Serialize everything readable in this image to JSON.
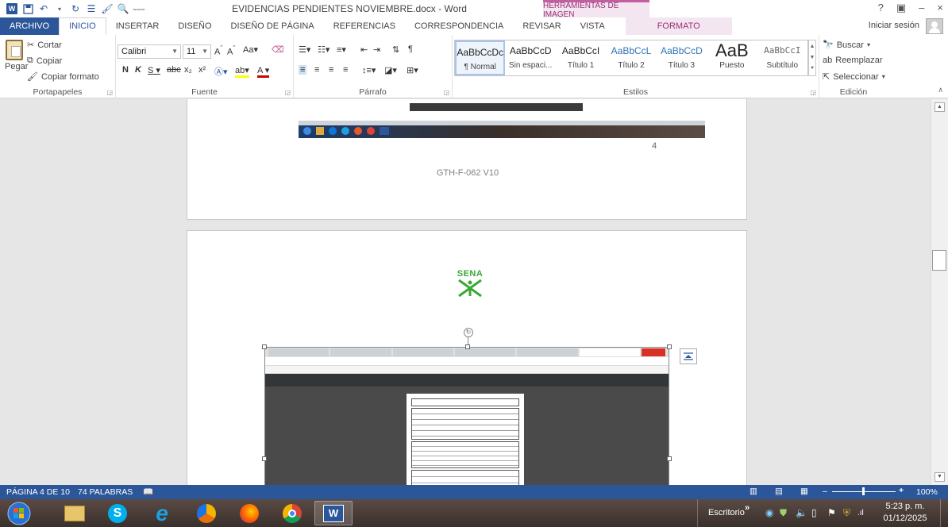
{
  "window": {
    "doc_title": "EVIDENCIAS PENDIENTES  NOVIEMBRE.docx - Word",
    "context_group": "HERRAMIENTAS DE IMAGEN",
    "controls": [
      "?",
      "▣",
      "–",
      "×"
    ]
  },
  "tabs": {
    "items": [
      "ARCHIVO",
      "INICIO",
      "INSERTAR",
      "DISEÑO",
      "DISEÑO DE PÁGINA",
      "REFERENCIAS",
      "CORRESPONDENCIA",
      "REVISAR",
      "VISTA",
      "FORMATO"
    ],
    "signin": "Iniciar sesión"
  },
  "ribbon": {
    "clipboard": {
      "paste": "Pegar",
      "cut": "Cortar",
      "copy": "Copiar",
      "format_painter": "Copiar formato",
      "label": "Portapapeles"
    },
    "font": {
      "name": "Calibri",
      "size": "11",
      "label": "Fuente"
    },
    "paragraph": {
      "label": "Párrafo"
    },
    "styles": {
      "label": "Estilos",
      "items": [
        {
          "sample": "AaBbCcDc",
          "name": "¶ Normal"
        },
        {
          "sample": "AaBbCcD",
          "name": "Sin espaci..."
        },
        {
          "sample": "AaBbCcI",
          "name": "Título 1"
        },
        {
          "sample": "AaBbCcL",
          "name": "Título 2"
        },
        {
          "sample": "AaBbCcD",
          "name": "Título 3"
        },
        {
          "sample": "AaB",
          "name": "Puesto"
        },
        {
          "sample": "AaBbCcI",
          "name": "Subtítulo"
        }
      ]
    },
    "editing": {
      "find": "Buscar",
      "replace": "Reemplazar",
      "select": "Seleccionar",
      "label": "Edición"
    }
  },
  "document": {
    "page_number": "4",
    "footer_code": "GTH-F-062 V10",
    "logo_text": "SENA"
  },
  "statusbar": {
    "page": "PÁGINA 4 DE 10",
    "words": "74 PALABRAS",
    "zoom": "100%"
  },
  "taskbar": {
    "desktop_label": "Escritorio",
    "time": "5:23 p. m.",
    "date": "01/12/2025"
  },
  "colors": {
    "word_blue": "#2b579a",
    "sena_green": "#39a935",
    "format_tab": "#9c2f76"
  }
}
